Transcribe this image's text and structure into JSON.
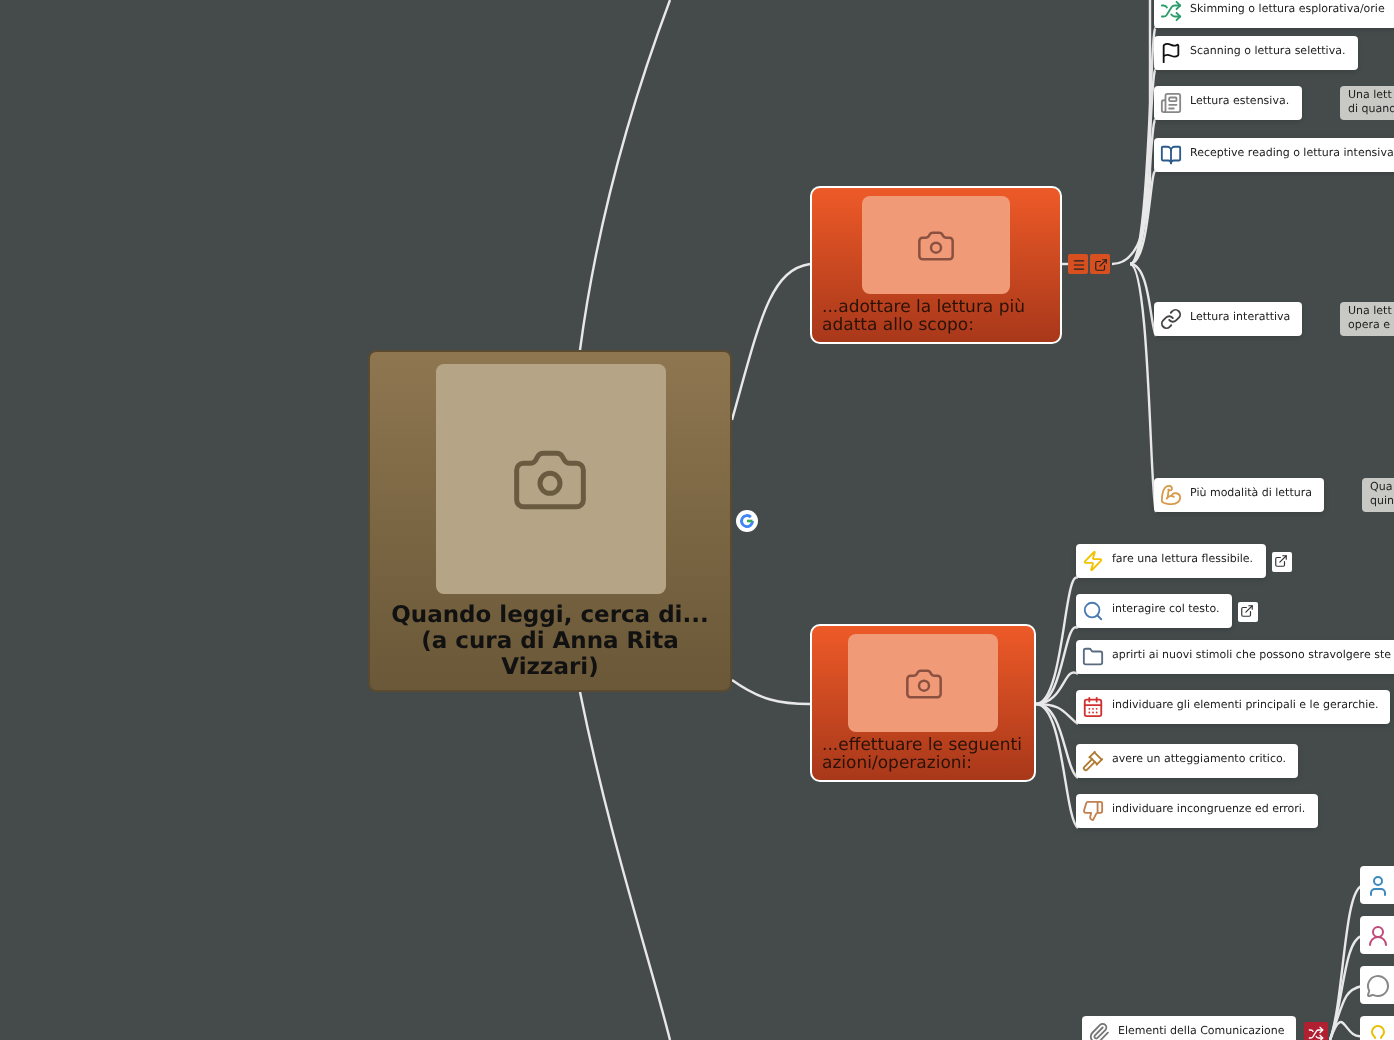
{
  "central": {
    "title": "Quando leggi, cerca di... (a cura di Anna Rita Vizzari)"
  },
  "branches": [
    {
      "title": "...adottare la lettura più adatta allo scopo:",
      "children": [
        {
          "label": "Skimming o lettura esplorativa/orie"
        },
        {
          "label": "Scanning o lettura selettiva.",
          "linked": false
        },
        {
          "label": "Lettura estensiva.",
          "linked": false,
          "note": [
            "Una lett",
            "di quand"
          ]
        },
        {
          "label": "Receptive reading o lettura intensiva"
        },
        {
          "label": "Lettura interattiva",
          "linked": false,
          "note": [
            "Una lett",
            "opera e"
          ]
        },
        {
          "label": "Più modalità di lettura",
          "linked": false,
          "note": [
            "Qua",
            "quin"
          ]
        }
      ]
    },
    {
      "title": "...effettuare le seguenti azioni/operazioni:",
      "children": [
        {
          "label": "fare una lettura flessibile.",
          "linked": true
        },
        {
          "label": "interagire col testo.",
          "linked": true
        },
        {
          "label": "aprirti ai nuovi stimoli che possono stravolgere ste"
        },
        {
          "label": "individuare gli elementi principali e le gerarchie.",
          "linked": false
        },
        {
          "label": "avere un atteggiamento critico.",
          "linked": false
        },
        {
          "label": "individuare incongruenze ed errori.",
          "linked": false
        }
      ]
    }
  ],
  "bottom": {
    "label": "Elementi della Comunicazione"
  }
}
